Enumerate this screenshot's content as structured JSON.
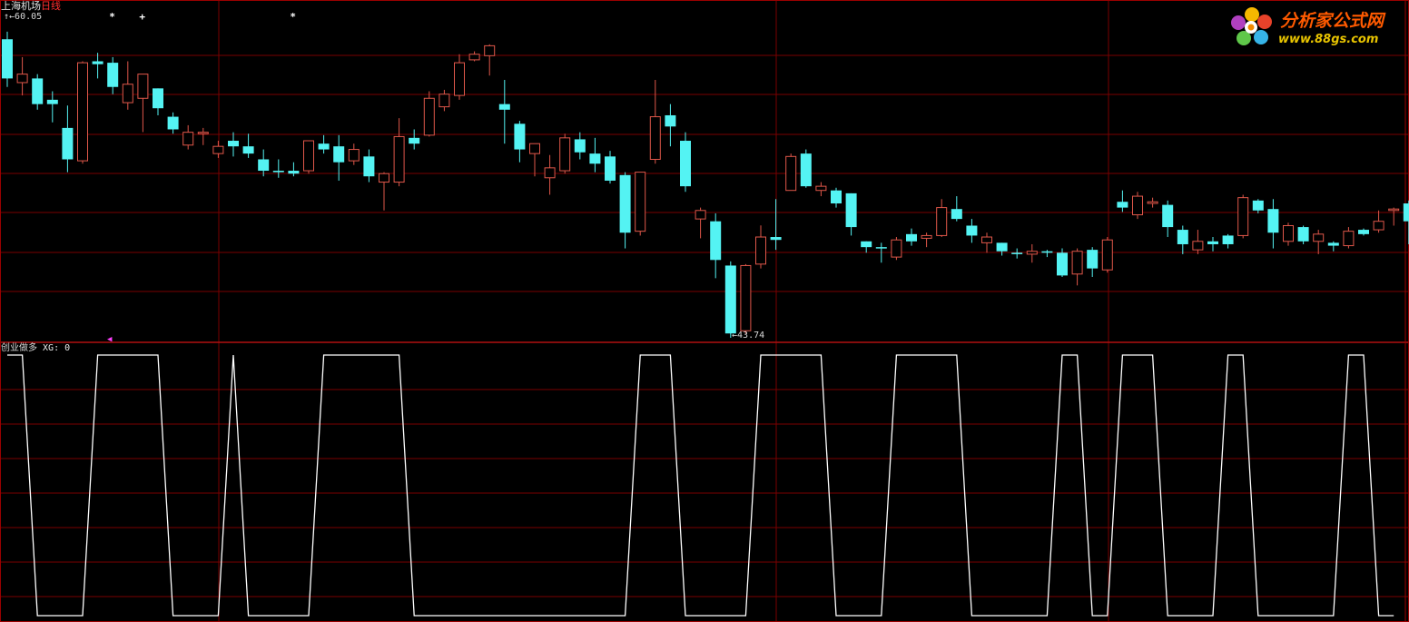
{
  "header": {
    "stock_name": "上海机场",
    "period": "日线",
    "high_label": "60.05",
    "low_label": "43.74"
  },
  "indicator": {
    "name": "创业做多",
    "xg_label": "XG: 0"
  },
  "logo": {
    "text": "分析家公式网",
    "url": "www.88gs.com"
  },
  "colors": {
    "up": "#e0574a",
    "down": "#54f3f3",
    "grid": "#7a0000",
    "line": "#ffffff"
  },
  "chart_data": [
    {
      "type": "candlestick",
      "title": "上海机场 日线",
      "ylim": [
        43.5,
        61.5
      ],
      "high_marker": 60.05,
      "low_marker": 43.74,
      "signal_markers": [
        {
          "bar": 7,
          "symbol": "*"
        },
        {
          "bar": 9,
          "symbol": "+"
        },
        {
          "bar": 19,
          "symbol": "*"
        }
      ],
      "candles": [
        {
          "o": 60.03,
          "h": 60.45,
          "l": 57.39,
          "c": 57.86,
          "up": false
        },
        {
          "o": 57.63,
          "h": 59.04,
          "l": 56.92,
          "c": 58.1,
          "up": true
        },
        {
          "o": 57.86,
          "h": 58.1,
          "l": 56.13,
          "c": 56.44,
          "up": false
        },
        {
          "o": 56.68,
          "h": 57.15,
          "l": 55.43,
          "c": 56.44,
          "up": false
        },
        {
          "o": 55.12,
          "h": 56.36,
          "l": 52.67,
          "c": 53.38,
          "up": false
        },
        {
          "o": 53.3,
          "h": 58.81,
          "l": 53.14,
          "c": 58.73,
          "up": true
        },
        {
          "o": 58.81,
          "h": 59.28,
          "l": 57.86,
          "c": 58.65,
          "up": false
        },
        {
          "o": 58.73,
          "h": 59.04,
          "l": 56.99,
          "c": 57.39,
          "up": false
        },
        {
          "o": 56.52,
          "h": 58.81,
          "l": 56.13,
          "c": 57.54,
          "up": true
        },
        {
          "o": 56.76,
          "h": 58.1,
          "l": 54.89,
          "c": 58.1,
          "up": true
        },
        {
          "o": 57.31,
          "h": 57.31,
          "l": 55.82,
          "c": 56.21,
          "up": false
        },
        {
          "o": 55.74,
          "h": 55.98,
          "l": 54.8,
          "c": 55.04,
          "up": false
        },
        {
          "o": 54.17,
          "h": 55.27,
          "l": 53.93,
          "c": 54.88,
          "up": true
        },
        {
          "o": 54.88,
          "h": 55.12,
          "l": 54.17,
          "c": 54.8,
          "up": true
        },
        {
          "o": 53.7,
          "h": 54.41,
          "l": 53.46,
          "c": 54.1,
          "up": true
        },
        {
          "o": 54.41,
          "h": 54.88,
          "l": 53.54,
          "c": 54.1,
          "up": false
        },
        {
          "o": 54.1,
          "h": 54.8,
          "l": 53.46,
          "c": 53.7,
          "up": false
        },
        {
          "o": 53.38,
          "h": 53.93,
          "l": 52.44,
          "c": 52.75,
          "up": false
        },
        {
          "o": 52.75,
          "h": 53.38,
          "l": 52.36,
          "c": 52.67,
          "up": false
        },
        {
          "o": 52.75,
          "h": 53.22,
          "l": 52.44,
          "c": 52.59,
          "up": false
        },
        {
          "o": 52.75,
          "h": 54.41,
          "l": 52.59,
          "c": 54.41,
          "up": true
        },
        {
          "o": 54.25,
          "h": 54.72,
          "l": 53.7,
          "c": 53.93,
          "up": false
        },
        {
          "o": 54.1,
          "h": 54.72,
          "l": 52.2,
          "c": 53.22,
          "up": false
        },
        {
          "o": 53.3,
          "h": 54.25,
          "l": 53.07,
          "c": 53.93,
          "up": true
        },
        {
          "o": 53.54,
          "h": 53.93,
          "l": 52.12,
          "c": 52.44,
          "up": false
        },
        {
          "o": 52.12,
          "h": 52.67,
          "l": 50.55,
          "c": 52.59,
          "up": true
        },
        {
          "o": 52.12,
          "h": 55.66,
          "l": 51.89,
          "c": 54.64,
          "up": true
        },
        {
          "o": 54.57,
          "h": 55.04,
          "l": 53.93,
          "c": 54.25,
          "up": false
        },
        {
          "o": 54.72,
          "h": 57.15,
          "l": 54.64,
          "c": 56.76,
          "up": true
        },
        {
          "o": 56.29,
          "h": 57.23,
          "l": 56.05,
          "c": 56.99,
          "up": true
        },
        {
          "o": 56.92,
          "h": 59.2,
          "l": 56.68,
          "c": 58.73,
          "up": true
        },
        {
          "o": 58.89,
          "h": 59.36,
          "l": 58.81,
          "c": 59.2,
          "up": true
        },
        {
          "o": 59.12,
          "h": 59.75,
          "l": 58.02,
          "c": 59.67,
          "up": true
        },
        {
          "o": 56.44,
          "h": 57.78,
          "l": 54.25,
          "c": 56.13,
          "up": false
        },
        {
          "o": 55.35,
          "h": 55.51,
          "l": 53.22,
          "c": 53.93,
          "up": false
        },
        {
          "o": 53.7,
          "h": 54.25,
          "l": 52.44,
          "c": 54.25,
          "up": true
        },
        {
          "o": 52.36,
          "h": 53.62,
          "l": 51.42,
          "c": 52.91,
          "up": true
        },
        {
          "o": 52.75,
          "h": 54.8,
          "l": 52.59,
          "c": 54.57,
          "up": true
        },
        {
          "o": 54.49,
          "h": 54.88,
          "l": 53.38,
          "c": 53.77,
          "up": false
        },
        {
          "o": 53.7,
          "h": 54.57,
          "l": 52.67,
          "c": 53.14,
          "up": false
        },
        {
          "o": 53.54,
          "h": 53.85,
          "l": 52.04,
          "c": 52.2,
          "up": false
        },
        {
          "o": 52.51,
          "h": 52.67,
          "l": 48.45,
          "c": 49.32,
          "up": false
        },
        {
          "o": 49.4,
          "h": 52.67,
          "l": 49.16,
          "c": 52.67,
          "up": true
        },
        {
          "o": 53.38,
          "h": 57.78,
          "l": 53.14,
          "c": 55.74,
          "up": true
        },
        {
          "o": 55.82,
          "h": 56.44,
          "l": 54.1,
          "c": 55.2,
          "up": false
        },
        {
          "o": 54.41,
          "h": 54.88,
          "l": 51.58,
          "c": 51.89,
          "up": false
        },
        {
          "o": 50.08,
          "h": 50.71,
          "l": 49.01,
          "c": 50.55,
          "up": true
        },
        {
          "o": 49.95,
          "h": 50.39,
          "l": 46.8,
          "c": 47.81,
          "up": false
        },
        {
          "o": 47.5,
          "h": 47.73,
          "l": 43.5,
          "c": 43.74,
          "up": false
        },
        {
          "o": 43.89,
          "h": 47.58,
          "l": 43.74,
          "c": 47.5,
          "up": true
        },
        {
          "o": 47.58,
          "h": 49.72,
          "l": 47.34,
          "c": 49.08,
          "up": true
        },
        {
          "o": 49.08,
          "h": 51.18,
          "l": 48.37,
          "c": 48.92,
          "up": false
        },
        {
          "o": 51.66,
          "h": 53.7,
          "l": 51.66,
          "c": 53.54,
          "up": true
        },
        {
          "o": 53.7,
          "h": 53.93,
          "l": 51.81,
          "c": 51.89,
          "up": false
        },
        {
          "o": 51.89,
          "h": 52.12,
          "l": 51.34,
          "c": 51.66,
          "up": true
        },
        {
          "o": 51.66,
          "h": 51.81,
          "l": 50.71,
          "c": 50.94,
          "up": false
        },
        {
          "o": 51.5,
          "h": 51.5,
          "l": 49.16,
          "c": 49.63,
          "up": false
        },
        {
          "o": 48.84,
          "h": 48.84,
          "l": 48.21,
          "c": 48.52,
          "up": false
        },
        {
          "o": 48.52,
          "h": 48.76,
          "l": 47.66,
          "c": 48.45,
          "up": false
        },
        {
          "o": 47.97,
          "h": 49.08,
          "l": 47.81,
          "c": 48.92,
          "up": true
        },
        {
          "o": 49.24,
          "h": 49.55,
          "l": 48.6,
          "c": 48.84,
          "up": false
        },
        {
          "o": 49.16,
          "h": 49.32,
          "l": 48.52,
          "c": 49.01,
          "up": true
        },
        {
          "o": 49.16,
          "h": 51.18,
          "l": 49.08,
          "c": 50.71,
          "up": true
        },
        {
          "o": 50.63,
          "h": 51.34,
          "l": 49.95,
          "c": 50.08,
          "up": false
        },
        {
          "o": 49.71,
          "h": 50.08,
          "l": 48.76,
          "c": 49.16,
          "up": false
        },
        {
          "o": 48.76,
          "h": 49.32,
          "l": 48.21,
          "c": 49.08,
          "up": true
        },
        {
          "o": 48.76,
          "h": 48.76,
          "l": 48.05,
          "c": 48.29,
          "up": false
        },
        {
          "o": 48.21,
          "h": 48.45,
          "l": 47.89,
          "c": 48.13,
          "up": false
        },
        {
          "o": 48.13,
          "h": 48.68,
          "l": 47.66,
          "c": 48.29,
          "up": true
        },
        {
          "o": 48.29,
          "h": 48.37,
          "l": 47.97,
          "c": 48.21,
          "up": false
        },
        {
          "o": 48.21,
          "h": 48.45,
          "l": 46.87,
          "c": 46.95,
          "up": false
        },
        {
          "o": 47.03,
          "h": 48.45,
          "l": 46.4,
          "c": 48.29,
          "up": true
        },
        {
          "o": 48.37,
          "h": 48.52,
          "l": 46.87,
          "c": 47.34,
          "up": false
        },
        {
          "o": 47.26,
          "h": 49.08,
          "l": 47.11,
          "c": 48.92,
          "up": true
        },
        {
          "o": 51.03,
          "h": 51.66,
          "l": 50.47,
          "c": 50.71,
          "up": false
        },
        {
          "o": 50.31,
          "h": 51.58,
          "l": 50.08,
          "c": 51.34,
          "up": true
        },
        {
          "o": 50.94,
          "h": 51.26,
          "l": 50.71,
          "c": 51.03,
          "up": true
        },
        {
          "o": 50.86,
          "h": 51.1,
          "l": 49.08,
          "c": 49.63,
          "up": false
        },
        {
          "o": 49.48,
          "h": 49.71,
          "l": 48.13,
          "c": 48.68,
          "up": false
        },
        {
          "o": 48.37,
          "h": 49.48,
          "l": 48.13,
          "c": 48.84,
          "up": true
        },
        {
          "o": 48.68,
          "h": 49.08,
          "l": 48.29,
          "c": 48.84,
          "up": false
        },
        {
          "o": 49.16,
          "h": 49.24,
          "l": 48.45,
          "c": 48.68,
          "up": false
        },
        {
          "o": 49.16,
          "h": 51.42,
          "l": 49.01,
          "c": 51.26,
          "up": true
        },
        {
          "o": 51.1,
          "h": 51.18,
          "l": 50.39,
          "c": 50.55,
          "up": false
        },
        {
          "o": 50.63,
          "h": 51.18,
          "l": 48.45,
          "c": 49.32,
          "up": false
        },
        {
          "o": 48.84,
          "h": 49.87,
          "l": 48.6,
          "c": 49.71,
          "up": true
        },
        {
          "o": 49.63,
          "h": 49.71,
          "l": 48.68,
          "c": 48.84,
          "up": false
        },
        {
          "o": 48.84,
          "h": 49.48,
          "l": 48.13,
          "c": 49.24,
          "up": true
        },
        {
          "o": 48.76,
          "h": 48.84,
          "l": 48.29,
          "c": 48.6,
          "up": false
        },
        {
          "o": 48.6,
          "h": 49.63,
          "l": 48.45,
          "c": 49.4,
          "up": true
        },
        {
          "o": 49.48,
          "h": 49.55,
          "l": 49.16,
          "c": 49.24,
          "up": false
        },
        {
          "o": 49.48,
          "h": 50.55,
          "l": 49.32,
          "c": 49.95,
          "up": true
        },
        {
          "o": 50.55,
          "h": 50.71,
          "l": 49.71,
          "c": 50.63,
          "up": true
        },
        {
          "o": 50.94,
          "h": 51.1,
          "l": 48.68,
          "c": 49.95,
          "up": false
        }
      ]
    },
    {
      "type": "line",
      "title": "创业做多",
      "ylim": [
        0,
        1
      ],
      "series": [
        {
          "name": "XG",
          "values": [
            1,
            1,
            0,
            0,
            0,
            0,
            1,
            1,
            1,
            1,
            1,
            0,
            0,
            0,
            0,
            1,
            0,
            0,
            0,
            0,
            0,
            1,
            1,
            1,
            1,
            1,
            1,
            0,
            0,
            0,
            0,
            0,
            0,
            0,
            0,
            0,
            0,
            0,
            0,
            0,
            0,
            0,
            1,
            1,
            1,
            0,
            0,
            0,
            0,
            0,
            1,
            1,
            1,
            1,
            1,
            0,
            0,
            0,
            0,
            1,
            1,
            1,
            1,
            1,
            0,
            0,
            0,
            0,
            0,
            0,
            1,
            1,
            0,
            0,
            1,
            1,
            1,
            0,
            0,
            0,
            0,
            1,
            1,
            0,
            0,
            0,
            0,
            0,
            0,
            1,
            1,
            0,
            0
          ]
        }
      ]
    }
  ]
}
